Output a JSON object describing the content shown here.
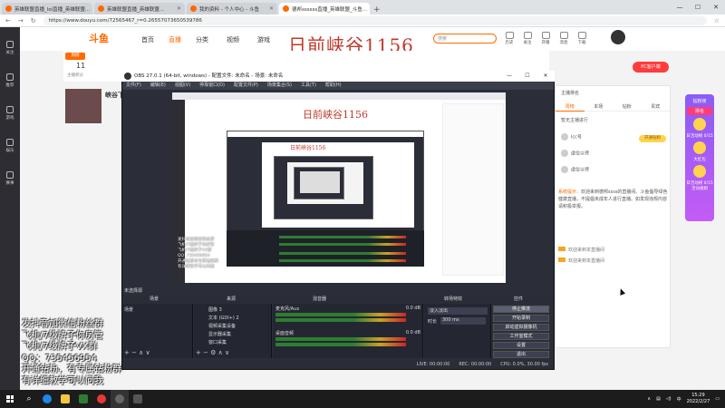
{
  "browser": {
    "tabs": [
      {
        "label": "英雄联盟直播_lol直播_英雄联盟..."
      },
      {
        "label": "英雄联盟直播_英雄联盟..."
      },
      {
        "label": "我的资料 - 个人中心 - 斗鱼"
      },
      {
        "label": "德邦ssssss直播_英雄联盟_斗鱼..."
      }
    ],
    "new_tab": "+",
    "url": "https://www.douyu.com/72565467_r=0.26557073650539786"
  },
  "window_controls": {
    "minimize": "—",
    "maximize": "☐",
    "close": "✕"
  },
  "douyu": {
    "logo": "斗鱼",
    "nav": [
      "首页",
      "直播",
      "分类",
      "视频",
      "游戏"
    ],
    "search_placeholder": "搜索",
    "top_icons": [
      "历史",
      "关注",
      "开播",
      "消息",
      "下载"
    ],
    "big_title": "日前峡谷1156",
    "hot_badge": "周榜",
    "hot_num": "11",
    "hot_label": "主播积分",
    "streamer_name": "峡谷下",
    "pc_app": "PC客户端",
    "left_nav": [
      "关注",
      "推荐",
      "游戏",
      "娱乐",
      "赛事"
    ],
    "right_panel": {
      "row1": "主播排名",
      "row2": "暂无主播进行",
      "tabs": [
        "周榜",
        "本场",
        "钻粉",
        "贵宾"
      ],
      "users": [
        "lcc号",
        "虚位以待",
        "虚位以待"
      ],
      "btn": "开通钻粉",
      "welcome_prefix": "系统提示：",
      "welcome": "欢迎来到德邦ssss的直播间。斗鱼倡导绿色健康直播，不提倡未成年人进行直播。如发现违规内容请积极举报。",
      "chat": [
        "欢迎来到本直播间",
        "欢迎来到本直播间"
      ]
    },
    "promo": {
      "head": "钻粉夜",
      "rank": "排名",
      "items": [
        "日活动榜 0/15",
        "大红包",
        "日活动榜 0/15",
        "日活动榜 0/15"
      ],
      "foot": "活动规则"
    }
  },
  "obs": {
    "title": "OBS 27.0.1 (64-bit, windows) - 配置文件: 未命名 - 场景: 未命名",
    "menu": [
      "文件(F)",
      "编辑(E)",
      "视图(V)",
      "停靠窗口(D)",
      "配置文件(P)",
      "场景集合(S)",
      "工具(T)",
      "帮助(H)"
    ],
    "preview_title": "日前峡谷1156",
    "preview_title_small": "日前峡谷1156",
    "overlay_lines": [
      "发抖音加微信粉丝群",
      "飞机/7级牌子你房管",
      "飞机/7级牌子VX群",
      "QQ: 735456954",
      "开通钻粉有专属钻粉群",
      "有详细教学可以问我"
    ],
    "no_source": "未选择源",
    "docks": {
      "scenes": "场景",
      "sources": "来源",
      "mixer": "混音器",
      "transitions": "转场特效",
      "controls": "控件"
    },
    "scene_item": "场景",
    "sources": [
      "图像 3",
      "文本 (GDI+) 2",
      "视频采集设备",
      "显示器采集",
      "窗口采集"
    ],
    "mixer": [
      {
        "name": "麦克风/Aux",
        "db": "0.0 dB"
      },
      {
        "name": "桌面音频",
        "db": "0.0 dB"
      }
    ],
    "transition": {
      "type": "淡入淡出",
      "duration_label": "时长",
      "duration": "300 ms"
    },
    "controls": [
      "停止推流",
      "开始录制",
      "启动虚拟摄像机",
      "工作室模式",
      "设置",
      "退出"
    ],
    "status": [
      "LIVE: 00:00:00",
      "REC: 00:00:00",
      "CPU: 0.0%, 30.00 fps"
    ]
  },
  "overlay_promo": [
    "发抖音加微信粉丝群",
    "飞机/7级牌子你房管",
    "飞机/7级牌子VX群",
    "QQ：735456954",
    "开通钻粉，有专属钻粉群",
    "有详细教学可以问我"
  ],
  "taskbar": {
    "time": "15:29",
    "date": "2022/2/27",
    "lang": "中"
  }
}
